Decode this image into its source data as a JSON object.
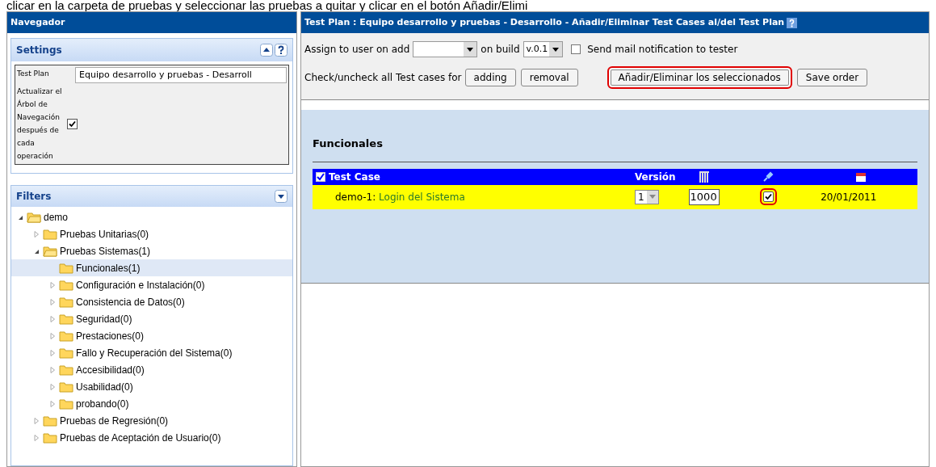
{
  "caption": "clicar en la carpeta de pruebas y seleccionar las pruebas a quitar y clicar en el botón Añadir/Elimi",
  "navigator": {
    "title": "Navegador",
    "settings": {
      "title": "Settings",
      "test_plan_label": "Test Plan",
      "test_plan_value": "Equipo desarrollo y pruebas - Desarroll",
      "refresh_label": "Actualizar el Árbol de Navegación después de cada operación",
      "refresh_checked": true
    },
    "filters": {
      "title": "Filters"
    },
    "tree": [
      {
        "label": "demo",
        "expanded": true,
        "selected": false,
        "children": [
          {
            "label": "Pruebas Unitarias(0)",
            "expanded": false,
            "selected": false
          },
          {
            "label": "Pruebas Sistemas(1)",
            "expanded": true,
            "selected": false,
            "children": [
              {
                "label": "Funcionales(1)",
                "expanded": false,
                "selected": true
              },
              {
                "label": "Configuración e Instalación(0)",
                "expanded": false,
                "selected": false
              },
              {
                "label": "Consistencia de Datos(0)",
                "expanded": false,
                "selected": false
              },
              {
                "label": "Seguridad(0)",
                "expanded": false,
                "selected": false
              },
              {
                "label": "Prestaciones(0)",
                "expanded": false,
                "selected": false
              },
              {
                "label": "Fallo y Recuperación del Sistema(0)",
                "expanded": false,
                "selected": false
              },
              {
                "label": "Accesibilidad(0)",
                "expanded": false,
                "selected": false
              },
              {
                "label": "Usabilidad(0)",
                "expanded": false,
                "selected": false
              },
              {
                "label": "probando(0)",
                "expanded": false,
                "selected": false
              }
            ]
          },
          {
            "label": "Pruebas de Regresión(0)",
            "expanded": false,
            "selected": false
          },
          {
            "label": "Pruebas de Aceptación de Usuario(0)",
            "expanded": false,
            "selected": false
          }
        ]
      }
    ]
  },
  "main": {
    "title": "Test Plan : Equipo desarrollo y pruebas - Desarrollo - Añadir/Eliminar Test Cases al/del Test Plan",
    "assign_label": "Assign to user on add",
    "build_label": "on build",
    "build_value": "v.0.1",
    "mail_label": "Send mail notification to tester",
    "mail_checked": false,
    "check_label": "Check/uncheck all Test cases for",
    "buttons": [
      {
        "label": "adding",
        "highlighted": false
      },
      {
        "label": "removal",
        "highlighted": false
      },
      {
        "label": "Añadir/Eliminar los seleccionados",
        "highlighted": true
      },
      {
        "label": "Save order",
        "highlighted": false
      }
    ],
    "section_title": "Funcionales",
    "table": {
      "columns": [
        "Test Case",
        "Versión"
      ],
      "rows": [
        {
          "id": "demo-1:",
          "name": "Login del Sistema",
          "version": "1",
          "order": "1000",
          "checked": true,
          "highlighted": true,
          "date": "20/01/2011"
        }
      ]
    }
  }
}
